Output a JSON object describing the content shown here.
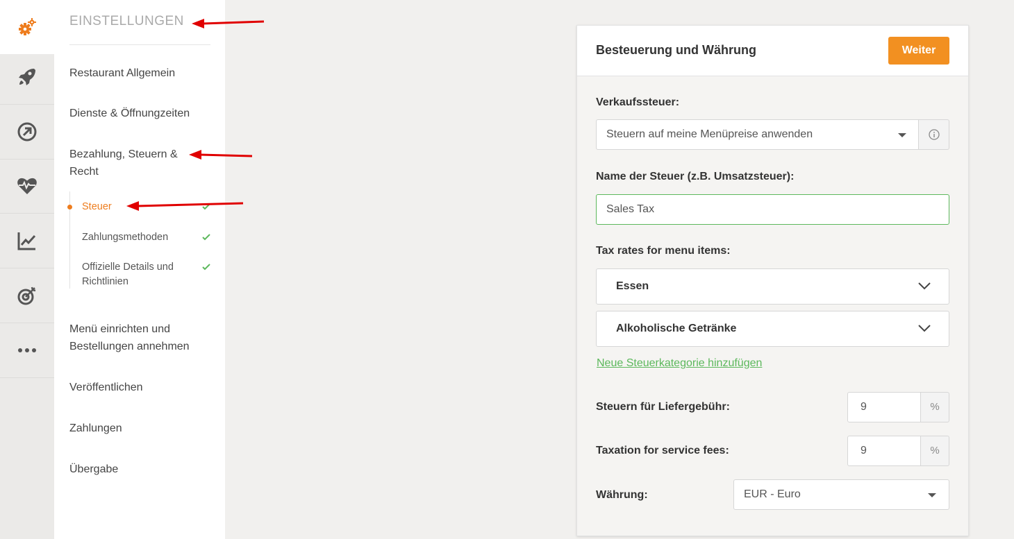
{
  "rail": {
    "items": [
      {
        "icon": "gears-icon",
        "active": true
      },
      {
        "icon": "rocket-icon"
      },
      {
        "icon": "circle-arrow-icon"
      },
      {
        "icon": "heart-pulse-icon"
      },
      {
        "icon": "line-chart-icon"
      },
      {
        "icon": "target-icon"
      },
      {
        "icon": "more-dots-icon"
      }
    ]
  },
  "sidebar": {
    "title": "EINSTELLUNGEN",
    "items": [
      {
        "label": "Restaurant Allgemein"
      },
      {
        "label": "Dienste & Öffnungzeiten"
      },
      {
        "label": "Bezahlung, Steuern & Recht"
      },
      {
        "label": "Menü einrichten und Bestellungen annehmen"
      },
      {
        "label": "Veröffentlichen"
      },
      {
        "label": "Zahlungen"
      },
      {
        "label": "Übergabe"
      }
    ],
    "subitems": [
      {
        "label": "Steuer",
        "active": true,
        "done": true
      },
      {
        "label": "Zahlungsmethoden",
        "done": true
      },
      {
        "label": "Offizielle Details und Richtlinien",
        "done": true
      }
    ]
  },
  "card": {
    "title": "Besteuerung und Währung",
    "next_button": "Weiter",
    "sales_tax": {
      "label": "Verkaufssteuer:",
      "selected": "Steuern auf meine Menüpreise anwenden"
    },
    "tax_name": {
      "label": "Name der Steuer (z.B. Umsatzsteuer):",
      "value": "Sales Tax"
    },
    "tax_rates": {
      "label": "Tax rates for menu items:",
      "categories": [
        "Essen",
        "Alkoholische Getränke"
      ],
      "add_link": "Neue Steuerkategorie hinzufügen"
    },
    "delivery_tax": {
      "label": "Steuern für Liefergebühr:",
      "value": "9",
      "unit": "%"
    },
    "service_tax": {
      "label": "Taxation for service fees:",
      "value": "9",
      "unit": "%"
    },
    "currency": {
      "label": "Währung:",
      "selected": "EUR - Euro"
    }
  },
  "colors": {
    "accent": "#f29021",
    "active": "#ee7d1e",
    "success": "#5cb85c",
    "annotation": "#e00000"
  }
}
